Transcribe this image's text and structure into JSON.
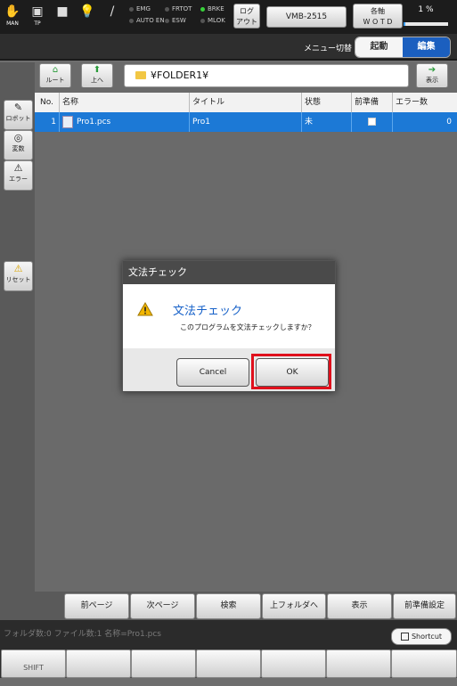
{
  "topbar": {
    "icons": [
      {
        "name": "man-hand-icon",
        "glyph": "✋",
        "label": "MAN"
      },
      {
        "name": "teach-pendant-icon",
        "glyph": "▣",
        "label": "TP"
      },
      {
        "name": "stop-icon",
        "glyph": "■",
        "label": ""
      },
      {
        "name": "lightbulb-icon",
        "glyph": "💡",
        "label": ""
      },
      {
        "name": "tool-icon",
        "glyph": "/",
        "label": ""
      }
    ],
    "lamps_col1": [
      {
        "label": "EMG",
        "on": false
      },
      {
        "label": "AUTO EN",
        "on": false
      }
    ],
    "lamps_col2": [
      {
        "label": "FRTOT",
        "on": false
      },
      {
        "label": "ESW",
        "on": false
      }
    ],
    "lamps_col3": [
      {
        "label": "BRKE",
        "on": true
      },
      {
        "label": "MLOK",
        "on": false
      }
    ],
    "logout_line1": "ログ",
    "logout_line2": "アウト",
    "robot_model": "VMB-2515",
    "axes_line1": "各軸",
    "axes_line2": "W O T D",
    "speed_label": "1 %",
    "speed_fraction": 0.01
  },
  "menu": {
    "label": "メニュー切替",
    "seg_start": "起動",
    "seg_edit": "編集"
  },
  "left_panel": [
    {
      "name": "robot-button",
      "icon": "wrench-icon",
      "glyph": "✎",
      "label": "ロボット"
    },
    {
      "name": "variable-button",
      "icon": "variable-icon",
      "glyph": "◎",
      "label": "変数"
    },
    {
      "name": "error-button",
      "icon": "error-icon",
      "glyph": "⚠",
      "label": "エラー"
    },
    {
      "name": "reset-button",
      "icon": "warning-icon",
      "glyph": "⚠",
      "label": "リセット"
    }
  ],
  "file_toolbar": {
    "root_label": "ルート",
    "up_label": "上へ",
    "path": "¥FOLDER1¥",
    "display_label": "表示"
  },
  "table": {
    "columns": [
      "No.",
      "名称",
      "タイトル",
      "状態",
      "前準備",
      "エラー数"
    ],
    "rows": [
      {
        "no": "1",
        "name": "Pro1.pcs",
        "title": "Pro1",
        "status": "未",
        "prep_checked": false,
        "errors": "0"
      }
    ]
  },
  "bottom_toolbar": [
    "前ページ",
    "次ページ",
    "検索",
    "上フォルダへ",
    "表示",
    "前準備設定"
  ],
  "status": {
    "text": "フォルダ数:0 ファイル数:1 名称=Pro1.pcs",
    "shortcut_label": "Shortcut"
  },
  "fkeys": [
    "SHIFT",
    "",
    "",
    "",
    "",
    "",
    ""
  ],
  "dialog": {
    "title": "文法チェック",
    "heading": "文法チェック",
    "message": "このプログラムを文法チェックしますか？",
    "cancel_label": "Cancel",
    "ok_label": "OK"
  },
  "colors": {
    "selected_row": "#1c79d6",
    "highlight": "#e0101c",
    "accent_blue": "#1b5fbf"
  }
}
